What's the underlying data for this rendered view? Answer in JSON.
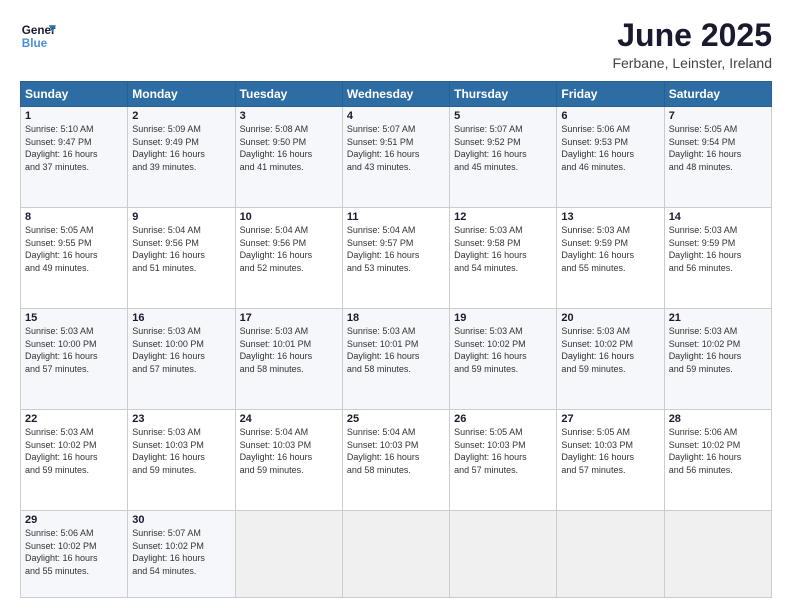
{
  "header": {
    "logo_line1": "General",
    "logo_line2": "Blue",
    "title": "June 2025",
    "subtitle": "Ferbane, Leinster, Ireland"
  },
  "days_of_week": [
    "Sunday",
    "Monday",
    "Tuesday",
    "Wednesday",
    "Thursday",
    "Friday",
    "Saturday"
  ],
  "weeks": [
    [
      {
        "day": "1",
        "info": "Sunrise: 5:10 AM\nSunset: 9:47 PM\nDaylight: 16 hours\nand 37 minutes."
      },
      {
        "day": "2",
        "info": "Sunrise: 5:09 AM\nSunset: 9:49 PM\nDaylight: 16 hours\nand 39 minutes."
      },
      {
        "day": "3",
        "info": "Sunrise: 5:08 AM\nSunset: 9:50 PM\nDaylight: 16 hours\nand 41 minutes."
      },
      {
        "day": "4",
        "info": "Sunrise: 5:07 AM\nSunset: 9:51 PM\nDaylight: 16 hours\nand 43 minutes."
      },
      {
        "day": "5",
        "info": "Sunrise: 5:07 AM\nSunset: 9:52 PM\nDaylight: 16 hours\nand 45 minutes."
      },
      {
        "day": "6",
        "info": "Sunrise: 5:06 AM\nSunset: 9:53 PM\nDaylight: 16 hours\nand 46 minutes."
      },
      {
        "day": "7",
        "info": "Sunrise: 5:05 AM\nSunset: 9:54 PM\nDaylight: 16 hours\nand 48 minutes."
      }
    ],
    [
      {
        "day": "8",
        "info": "Sunrise: 5:05 AM\nSunset: 9:55 PM\nDaylight: 16 hours\nand 49 minutes."
      },
      {
        "day": "9",
        "info": "Sunrise: 5:04 AM\nSunset: 9:56 PM\nDaylight: 16 hours\nand 51 minutes."
      },
      {
        "day": "10",
        "info": "Sunrise: 5:04 AM\nSunset: 9:56 PM\nDaylight: 16 hours\nand 52 minutes."
      },
      {
        "day": "11",
        "info": "Sunrise: 5:04 AM\nSunset: 9:57 PM\nDaylight: 16 hours\nand 53 minutes."
      },
      {
        "day": "12",
        "info": "Sunrise: 5:03 AM\nSunset: 9:58 PM\nDaylight: 16 hours\nand 54 minutes."
      },
      {
        "day": "13",
        "info": "Sunrise: 5:03 AM\nSunset: 9:59 PM\nDaylight: 16 hours\nand 55 minutes."
      },
      {
        "day": "14",
        "info": "Sunrise: 5:03 AM\nSunset: 9:59 PM\nDaylight: 16 hours\nand 56 minutes."
      }
    ],
    [
      {
        "day": "15",
        "info": "Sunrise: 5:03 AM\nSunset: 10:00 PM\nDaylight: 16 hours\nand 57 minutes."
      },
      {
        "day": "16",
        "info": "Sunrise: 5:03 AM\nSunset: 10:00 PM\nDaylight: 16 hours\nand 57 minutes."
      },
      {
        "day": "17",
        "info": "Sunrise: 5:03 AM\nSunset: 10:01 PM\nDaylight: 16 hours\nand 58 minutes."
      },
      {
        "day": "18",
        "info": "Sunrise: 5:03 AM\nSunset: 10:01 PM\nDaylight: 16 hours\nand 58 minutes."
      },
      {
        "day": "19",
        "info": "Sunrise: 5:03 AM\nSunset: 10:02 PM\nDaylight: 16 hours\nand 59 minutes."
      },
      {
        "day": "20",
        "info": "Sunrise: 5:03 AM\nSunset: 10:02 PM\nDaylight: 16 hours\nand 59 minutes."
      },
      {
        "day": "21",
        "info": "Sunrise: 5:03 AM\nSunset: 10:02 PM\nDaylight: 16 hours\nand 59 minutes."
      }
    ],
    [
      {
        "day": "22",
        "info": "Sunrise: 5:03 AM\nSunset: 10:02 PM\nDaylight: 16 hours\nand 59 minutes."
      },
      {
        "day": "23",
        "info": "Sunrise: 5:03 AM\nSunset: 10:03 PM\nDaylight: 16 hours\nand 59 minutes."
      },
      {
        "day": "24",
        "info": "Sunrise: 5:04 AM\nSunset: 10:03 PM\nDaylight: 16 hours\nand 59 minutes."
      },
      {
        "day": "25",
        "info": "Sunrise: 5:04 AM\nSunset: 10:03 PM\nDaylight: 16 hours\nand 58 minutes."
      },
      {
        "day": "26",
        "info": "Sunrise: 5:05 AM\nSunset: 10:03 PM\nDaylight: 16 hours\nand 57 minutes."
      },
      {
        "day": "27",
        "info": "Sunrise: 5:05 AM\nSunset: 10:03 PM\nDaylight: 16 hours\nand 57 minutes."
      },
      {
        "day": "28",
        "info": "Sunrise: 5:06 AM\nSunset: 10:02 PM\nDaylight: 16 hours\nand 56 minutes."
      }
    ],
    [
      {
        "day": "29",
        "info": "Sunrise: 5:06 AM\nSunset: 10:02 PM\nDaylight: 16 hours\nand 55 minutes."
      },
      {
        "day": "30",
        "info": "Sunrise: 5:07 AM\nSunset: 10:02 PM\nDaylight: 16 hours\nand 54 minutes."
      },
      {
        "day": "",
        "info": ""
      },
      {
        "day": "",
        "info": ""
      },
      {
        "day": "",
        "info": ""
      },
      {
        "day": "",
        "info": ""
      },
      {
        "day": "",
        "info": ""
      }
    ]
  ]
}
